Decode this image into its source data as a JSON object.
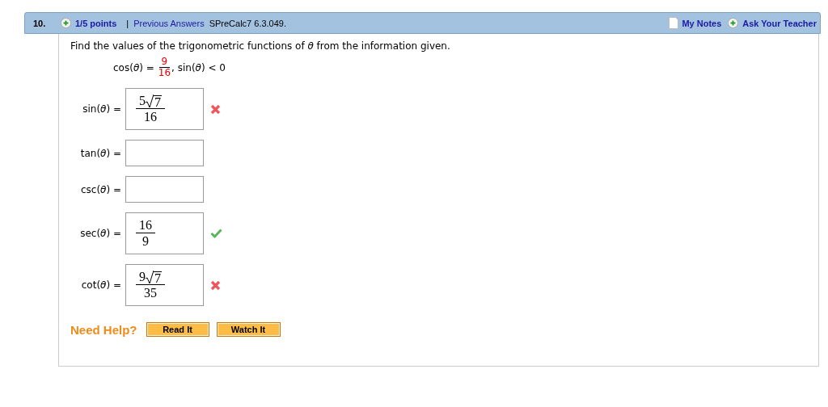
{
  "header": {
    "number": "10.",
    "points": "1/5 points",
    "separator": "|",
    "previous_answers": "Previous Answers",
    "reference": "SPreCalc7 6.3.049.",
    "my_notes": "My Notes",
    "ask_teacher": "Ask Your Teacher"
  },
  "prompt": "Find the values of the trigonometric functions of *θ* from the information given.",
  "given": {
    "lhs": "cos(*θ*) =",
    "numerator": "9",
    "denominator": "16",
    "rest": ", sin(*θ*) < 0"
  },
  "answers": [
    {
      "label": "sin(*θ*) =",
      "coefficient": "5",
      "radicand": "7",
      "denominator": "16",
      "correct": false
    },
    {
      "label": "tan(*θ*) ="
    },
    {
      "label": "csc(*θ*) ="
    },
    {
      "label": "sec(*θ*) =",
      "coefficient": "16",
      "denominator": "9",
      "correct": true
    },
    {
      "label": "cot(*θ*) =",
      "coefficient": "9",
      "radicand": "7",
      "denominator": "35",
      "correct": false
    }
  ],
  "help": {
    "label": "Need Help?",
    "buttons": [
      "Read It",
      "Watch It"
    ]
  }
}
